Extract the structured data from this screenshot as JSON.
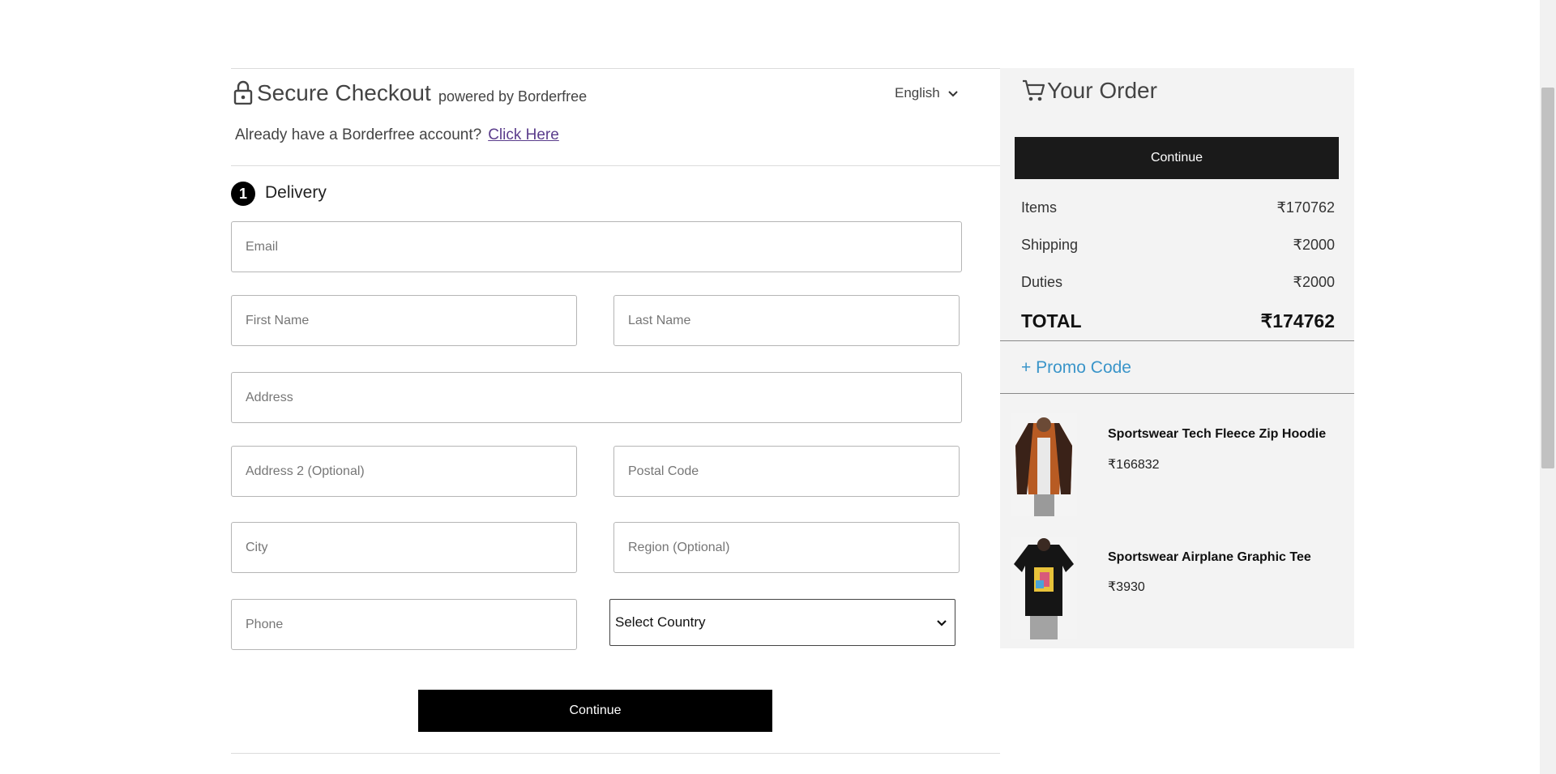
{
  "header": {
    "title": "Secure Checkout",
    "powered_by": "powered by Borderfree",
    "language": "English",
    "account_prompt": "Already have a Borderfree account?",
    "account_link": "Click Here"
  },
  "delivery": {
    "step_number": "1",
    "step_label": "Delivery",
    "fields": {
      "email": "Email",
      "first_name": "First Name",
      "last_name": "Last Name",
      "address": "Address",
      "address2": "Address 2 (Optional)",
      "postal_code": "Postal Code",
      "city": "City",
      "region": "Region (Optional)",
      "phone": "Phone"
    },
    "country_select": "Select Country",
    "continue_label": "Continue"
  },
  "order": {
    "title": "Your Order",
    "continue_label": "Continue",
    "items_label": "Items",
    "items_value": "₹170762",
    "shipping_label": "Shipping",
    "shipping_value": "₹2000",
    "duties_label": "Duties",
    "duties_value": "₹2000",
    "total_label": "TOTAL",
    "total_value": "₹174762",
    "promo_label": "+ Promo Code",
    "products": [
      {
        "name": "Sportswear Tech Fleece Zip Hoodie",
        "price": "₹166832"
      },
      {
        "name": "Sportswear Airplane Graphic Tee",
        "price": "₹3930"
      }
    ]
  },
  "icons": {
    "lock": "lock-icon",
    "cart": "cart-icon",
    "chevron": "chevron-down-icon"
  },
  "colors": {
    "link": "#5b3d8c",
    "promo": "#3a95c9",
    "button": "#000000",
    "sidebar_bg": "#f3f3f3"
  }
}
